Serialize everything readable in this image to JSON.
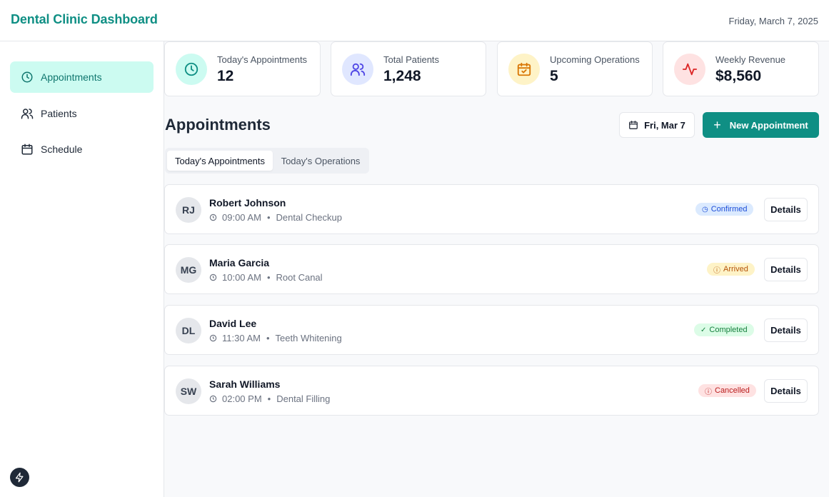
{
  "header": {
    "title": "Dental Clinic Dashboard",
    "date": "Friday, March 7, 2025"
  },
  "sidebar": {
    "items": [
      {
        "label": "Appointments",
        "icon": "clock-icon",
        "active": true
      },
      {
        "label": "Patients",
        "icon": "users-icon",
        "active": false
      },
      {
        "label": "Schedule",
        "icon": "calendar-icon",
        "active": false
      }
    ]
  },
  "stats": [
    {
      "label": "Today's Appointments",
      "value": "12",
      "icon": "clock-icon",
      "bg": "#ccfbf1",
      "fg": "#0f8f84"
    },
    {
      "label": "Total Patients",
      "value": "1,248",
      "icon": "users-icon",
      "bg": "#e0e7ff",
      "fg": "#4f46e5"
    },
    {
      "label": "Upcoming Operations",
      "value": "5",
      "icon": "calendar-check-icon",
      "bg": "#fef3c7",
      "fg": "#d97706"
    },
    {
      "label": "Weekly Revenue",
      "value": "$8,560",
      "icon": "activity-icon",
      "bg": "#fee2e2",
      "fg": "#dc2626"
    }
  ],
  "main": {
    "title": "Appointments",
    "date_button": "Fri, Mar 7",
    "new_button": "New Appointment",
    "tabs": [
      {
        "label": "Today's Appointments",
        "active": true
      },
      {
        "label": "Today's Operations",
        "active": false
      }
    ]
  },
  "appointments": [
    {
      "initials": "RJ",
      "name": "Robert Johnson",
      "time": "09:00 AM",
      "service": "Dental Checkup",
      "status": "Confirmed",
      "status_icon": "clock-icon",
      "details": "Details"
    },
    {
      "initials": "MG",
      "name": "Maria Garcia",
      "time": "10:00 AM",
      "service": "Root Canal",
      "status": "Arrived",
      "status_icon": "alert-icon",
      "details": "Details"
    },
    {
      "initials": "DL",
      "name": "David Lee",
      "time": "11:30 AM",
      "service": "Teeth Whitening",
      "status": "Completed",
      "status_icon": "check-icon",
      "details": "Details"
    },
    {
      "initials": "SW",
      "name": "Sarah Williams",
      "time": "02:00 PM",
      "service": "Dental Filling",
      "status": "Cancelled",
      "status_icon": "x-circle-icon",
      "details": "Details"
    }
  ],
  "status_colors": {
    "Confirmed": {
      "bg": "#dbeafe",
      "fg": "#1d4ed8"
    },
    "Arrived": {
      "bg": "#fef3c7",
      "fg": "#b45309"
    },
    "Completed": {
      "bg": "#dcfce7",
      "fg": "#15803d"
    },
    "Cancelled": {
      "bg": "#fee2e2",
      "fg": "#b91c1c"
    }
  },
  "accent": "#0f8f84"
}
